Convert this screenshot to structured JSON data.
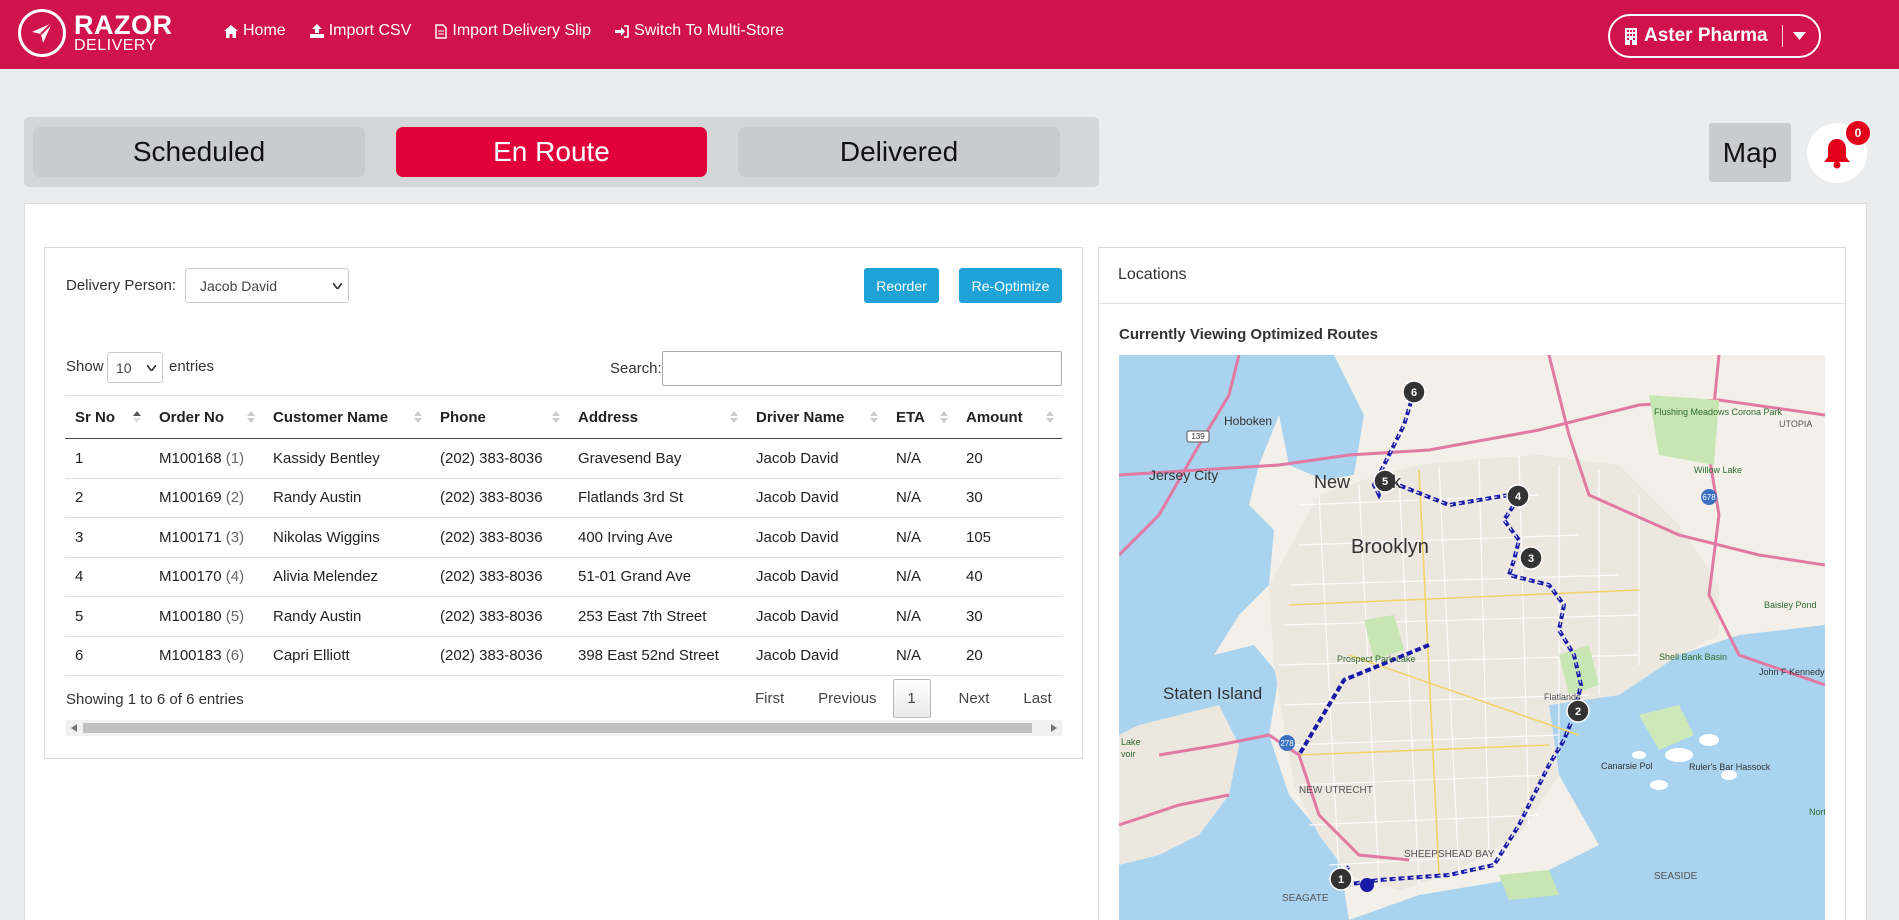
{
  "header": {
    "logo_line1": "RAZOR",
    "logo_line2": "DELIVERY",
    "nav": [
      {
        "label": "Home",
        "icon": "home-icon"
      },
      {
        "label": "Import CSV",
        "icon": "upload-icon"
      },
      {
        "label": "Import Delivery Slip",
        "icon": "file-icon"
      },
      {
        "label": "Switch To Multi-Store",
        "icon": "sign-in-icon"
      }
    ],
    "store": "Aster Pharma",
    "brand_color": "#d0134a"
  },
  "tabs": [
    {
      "label": "Scheduled",
      "active": false
    },
    {
      "label": "En Route",
      "active": true
    },
    {
      "label": "Delivered",
      "active": false
    }
  ],
  "map_button": "Map",
  "notifications": {
    "count": "0"
  },
  "orders_panel": {
    "delivery_person_label": "Delivery Person:",
    "delivery_person_value": "Jacob David",
    "reorder_label": "Reorder",
    "reoptimize_label": "Re-Optimize",
    "show_label": "Show",
    "entries_value": "10",
    "entries_label": "entries",
    "search_label": "Search:",
    "search_value": "",
    "columns": [
      "Sr No",
      "Order No",
      "Customer Name",
      "Phone",
      "Address",
      "Driver Name",
      "ETA",
      "Amount"
    ],
    "rows": [
      {
        "sr": "1",
        "order": "M100168",
        "seq": "(1)",
        "customer": "Kassidy Bentley",
        "phone": "(202) 383-8036",
        "address": "Gravesend Bay",
        "driver": "Jacob David",
        "eta": "N/A",
        "amount": "20"
      },
      {
        "sr": "2",
        "order": "M100169",
        "seq": "(2)",
        "customer": "Randy Austin",
        "phone": "(202) 383-8036",
        "address": "Flatlands 3rd St",
        "driver": "Jacob David",
        "eta": "N/A",
        "amount": "30"
      },
      {
        "sr": "3",
        "order": "M100171",
        "seq": "(3)",
        "customer": "Nikolas Wiggins",
        "phone": "(202) 383-8036",
        "address": "400 Irving Ave",
        "driver": "Jacob David",
        "eta": "N/A",
        "amount": "105"
      },
      {
        "sr": "4",
        "order": "M100170",
        "seq": "(4)",
        "customer": "Alivia Melendez",
        "phone": "(202) 383-8036",
        "address": "51-01 Grand Ave",
        "driver": "Jacob David",
        "eta": "N/A",
        "amount": "40"
      },
      {
        "sr": "5",
        "order": "M100180",
        "seq": "(5)",
        "customer": "Randy Austin",
        "phone": "(202) 383-8036",
        "address": "253 East 7th Street",
        "driver": "Jacob David",
        "eta": "N/A",
        "amount": "30"
      },
      {
        "sr": "6",
        "order": "M100183",
        "seq": "(6)",
        "customer": "Capri Elliott",
        "phone": "(202) 383-8036",
        "address": "398 East 52nd Street",
        "driver": "Jacob David",
        "eta": "N/A",
        "amount": "20"
      }
    ],
    "info": "Showing 1 to 6 of 6 entries",
    "pagination": {
      "first": "First",
      "previous": "Previous",
      "current": "1",
      "next": "Next",
      "last": "Last"
    }
  },
  "locations_panel": {
    "title": "Locations",
    "subtitle": "Currently Viewing Optimized Routes",
    "map_labels": [
      "Hoboken",
      "Jersey City",
      "New",
      "k",
      "Brooklyn",
      "Staten Island",
      "NEW UTRECHT",
      "SHEEPSHEAD BAY",
      "SEAGATE",
      "SEASIDE",
      "Canarsie Pol",
      "Prospect Park Lake",
      "Flushing Meadows Corona Park",
      "Willow Lake",
      "UTOPIA",
      "Baisley Pond",
      "Shell Bank Basin",
      "John F Kennedy Int'l Airport",
      "Ruler's Bar Hassock",
      "Norton",
      "Lake",
      "voir",
      "Flatlands",
      "139",
      "278",
      "678"
    ],
    "stops": [
      "1",
      "2",
      "3",
      "4",
      "5",
      "6"
    ],
    "route_color": "#1a1aa8"
  }
}
